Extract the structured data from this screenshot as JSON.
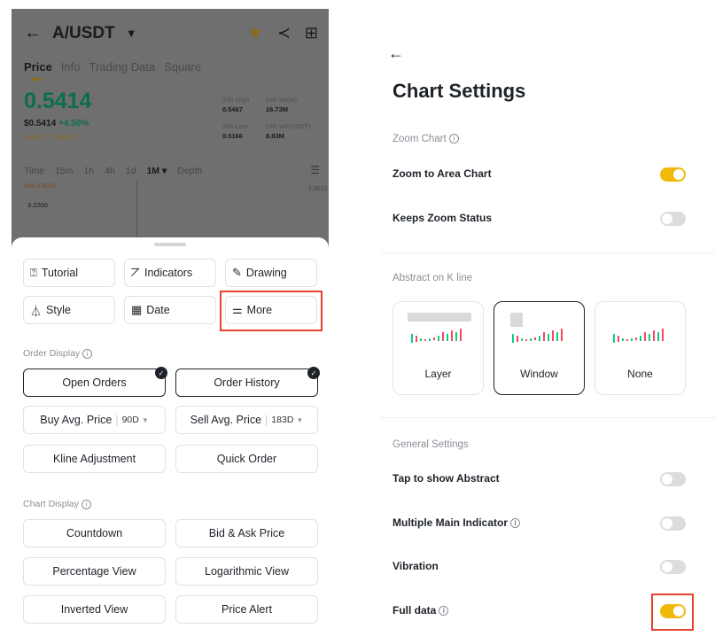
{
  "left": {
    "header": {
      "back_icon": "←",
      "pair": "A/USDT",
      "caret": "▼",
      "star_icon": "★",
      "share_icon": "≺",
      "grid_icon": "⊞"
    },
    "tabs": [
      "Price",
      "Info",
      "Trading Data",
      "Square"
    ],
    "price": "0.5414",
    "price_usd": "$0.5414",
    "change": "+4.50%",
    "tags": "Layer 1 / Layer 2",
    "stats": [
      {
        "label": "24h High",
        "value": "0.5467"
      },
      {
        "label": "24h Vol(A)",
        "value": "16.73M"
      },
      {
        "label": "24h Low",
        "value": "0.5166"
      },
      {
        "label": "24h Vol(USDT)",
        "value": "8.83M"
      }
    ],
    "timeframes": [
      "Time",
      "15m",
      "1h",
      "4h",
      "1d",
      "1M ▾",
      "Depth"
    ],
    "avl": "AVL 0.5018",
    "axis_right": "3.3610",
    "level": "3.2200",
    "tools": {
      "tutorial": "Tutorial",
      "indicators": "Indicators",
      "drawing": "Drawing",
      "style": "Style",
      "date": "Date",
      "more": "More"
    },
    "order_display": {
      "title": "Order Display",
      "open_orders": "Open Orders",
      "order_history": "Order History",
      "buy_avg": "Buy Avg. Price",
      "buy_period": "90D",
      "sell_avg": "Sell Avg. Price",
      "sell_period": "183D",
      "kline_adjustment": "Kline Adjustment",
      "quick_order": "Quick Order"
    },
    "chart_display": {
      "title": "Chart Display",
      "countdown": "Countdown",
      "bid_ask": "Bid & Ask Price",
      "percentage": "Percentage View",
      "logarithmic": "Logarithmic View",
      "inverted": "Inverted View",
      "price_alert": "Price Alert"
    }
  },
  "right": {
    "back_icon": "←",
    "title": "Chart Settings",
    "zoom_section": "Zoom Chart",
    "zoom_to_area": {
      "label": "Zoom to Area Chart",
      "on": true
    },
    "keeps_zoom": {
      "label": "Keeps Zoom Status",
      "on": false
    },
    "abstract_section": "Abstract on K line",
    "abstract_options": [
      "Layer",
      "Window",
      "None"
    ],
    "abstract_selected": "Window",
    "general_section": "General Settings",
    "tap_abstract": {
      "label": "Tap to show Abstract",
      "on": false
    },
    "multi_indicator": {
      "label": "Multiple Main Indicator",
      "on": false
    },
    "vibration": {
      "label": "Vibration",
      "on": false
    },
    "full_data": {
      "label": "Full data",
      "on": true
    }
  },
  "colors": {
    "accent": "#f0b90b",
    "up": "#0ecb81",
    "down": "#f6465d",
    "highlight": "#e8412c"
  }
}
